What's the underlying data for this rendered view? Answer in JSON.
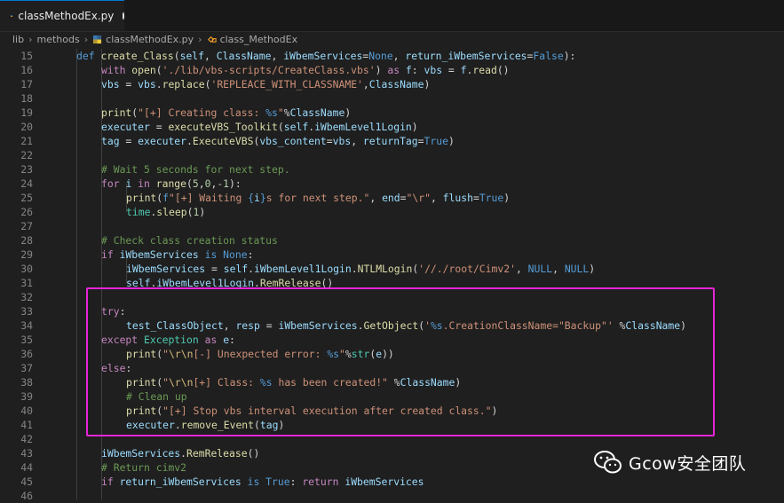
{
  "tab": {
    "filename": "classMethodEx.py"
  },
  "breadcrumb": {
    "part1": "lib",
    "part2": "methods",
    "part3": "classMethodEx.py",
    "part4": "class_MethodEx"
  },
  "code": {
    "l15": {
      "num": "15",
      "t1": "def ",
      "t2": "create_Class",
      "t3": "(",
      "t4": "self",
      "t5": ", ",
      "t6": "ClassName",
      "t7": ", ",
      "t8": "iWbemServices",
      "t9": "=",
      "t10": "None",
      "t11": ", ",
      "t12": "return_iWbemServices",
      "t13": "=",
      "t14": "False",
      "t15": "):"
    },
    "l16": {
      "num": "16",
      "t1": "with ",
      "t2": "open",
      "t3": "(",
      "t4": "'./lib/vbs-scripts/CreateClass.vbs'",
      "t5": ") ",
      "t6": "as ",
      "t7": "f",
      "t8": ": ",
      "t9": "vbs",
      "t10": " = ",
      "t11": "f",
      "t12": ".",
      "t13": "read",
      "t14": "()"
    },
    "l17": {
      "num": "17",
      "t1": "vbs",
      "t2": " = ",
      "t3": "vbs",
      "t4": ".",
      "t5": "replace",
      "t6": "(",
      "t7": "'REPLEACE_WITH_CLASSNAME'",
      "t8": ",",
      "t9": "ClassName",
      "t10": ")"
    },
    "l18": {
      "num": "18"
    },
    "l19": {
      "num": "19",
      "t1": "print",
      "t2": "(",
      "t3": "\"[+] Creating class: ",
      "t4": "%s",
      "t5": "\"",
      "t6": "%",
      "t7": "ClassName",
      "t8": ")"
    },
    "l20": {
      "num": "20",
      "t1": "executer",
      "t2": " = ",
      "t3": "executeVBS_Toolkit",
      "t4": "(",
      "t5": "self",
      "t6": ".",
      "t7": "iWbemLevel1Login",
      "t8": ")"
    },
    "l21": {
      "num": "21",
      "t1": "tag",
      "t2": " = ",
      "t3": "executer",
      "t4": ".",
      "t5": "ExecuteVBS",
      "t6": "(",
      "t7": "vbs_content",
      "t8": "=",
      "t9": "vbs",
      "t10": ", ",
      "t11": "returnTag",
      "t12": "=",
      "t13": "True",
      "t14": ")"
    },
    "l22": {
      "num": "22"
    },
    "l23": {
      "num": "23",
      "t1": "# Wait 5 seconds for next step."
    },
    "l24": {
      "num": "24",
      "t1": "for ",
      "t2": "i",
      "t3": " in ",
      "t4": "range",
      "t5": "(",
      "t6": "5",
      "t7": ",",
      "t8": "0",
      "t9": ",",
      "t10": "-1",
      "t11": "):"
    },
    "l25": {
      "num": "25",
      "t1": "print",
      "t2": "(",
      "t3": "f",
      "t4": "\"[+] Waiting ",
      "t5": "{",
      "t6": "i",
      "t7": "}",
      "t8": "s for next step.\"",
      "t9": ", ",
      "t10": "end",
      "t11": "=",
      "t12": "\"\\r\"",
      "t13": ", ",
      "t14": "flush",
      "t15": "=",
      "t16": "True",
      "t17": ")"
    },
    "l26": {
      "num": "26",
      "t1": "time",
      "t2": ".",
      "t3": "sleep",
      "t4": "(",
      "t5": "1",
      "t6": ")"
    },
    "l27": {
      "num": "27"
    },
    "l28": {
      "num": "28",
      "t1": "# Check class creation status"
    },
    "l29": {
      "num": "29",
      "t1": "if ",
      "t2": "iWbemServices",
      "t3": " is ",
      "t4": "None",
      "t5": ":"
    },
    "l30": {
      "num": "30",
      "t1": "iWbemServices",
      "t2": " = ",
      "t3": "self",
      "t4": ".",
      "t5": "iWbemLevel1Login",
      "t6": ".",
      "t7": "NTLMLogin",
      "t8": "(",
      "t9": "'//./root/Cimv2'",
      "t10": ", ",
      "t11": "NULL",
      "t12": ", ",
      "t13": "NULL",
      "t14": ")"
    },
    "l31": {
      "num": "31",
      "t1": "self",
      "t2": ".",
      "t3": "iWbemLevel1Login",
      "t4": ".",
      "t5": "RemRelease",
      "t6": "()"
    },
    "l32": {
      "num": "32"
    },
    "l33": {
      "num": "33",
      "t1": "try",
      "t2": ":"
    },
    "l34": {
      "num": "34",
      "t1": "test_ClassObject",
      "t2": ", ",
      "t3": "resp",
      "t4": " = ",
      "t5": "iWbemServices",
      "t6": ".",
      "t7": "GetObject",
      "t8": "(",
      "t9": "'",
      "t10": "%s",
      "t11": ".CreationClassName=\"Backup\"'",
      "t12": " ",
      "t13": "%",
      "t14": "ClassName",
      "t15": ")"
    },
    "l35": {
      "num": "35",
      "t1": "except ",
      "t2": "Exception",
      "t3": " as ",
      "t4": "e",
      "t5": ":"
    },
    "l36": {
      "num": "36",
      "t1": "print",
      "t2": "(",
      "t3": "\"",
      "t4": "\\r\\n",
      "t5": "[-] Unexpected error: ",
      "t6": "%s",
      "t7": "\"",
      "t8": "%",
      "t9": "str",
      "t10": "(",
      "t11": "e",
      "t12": "))"
    },
    "l37": {
      "num": "37",
      "t1": "else",
      "t2": ":"
    },
    "l38": {
      "num": "38",
      "t1": "print",
      "t2": "(",
      "t3": "\"",
      "t4": "\\r\\n",
      "t5": "[+] Class: ",
      "t6": "%s",
      "t7": " has been created!\"",
      "t8": " ",
      "t9": "%",
      "t10": "ClassName",
      "t11": ")"
    },
    "l39": {
      "num": "39",
      "t1": "# Clean up"
    },
    "l40": {
      "num": "40",
      "t1": "print",
      "t2": "(",
      "t3": "\"[+] Stop vbs interval execution after created class.\"",
      "t4": ")"
    },
    "l41": {
      "num": "41",
      "t1": "executer",
      "t2": ".",
      "t3": "remove_Event",
      "t4": "(",
      "t5": "tag",
      "t6": ")"
    },
    "l42": {
      "num": "42"
    },
    "l43": {
      "num": "43",
      "t1": "iWbemServices",
      "t2": ".",
      "t3": "RemRelease",
      "t4": "()"
    },
    "l44": {
      "num": "44",
      "t1": "# Return cimv2"
    },
    "l45": {
      "num": "45",
      "t1": "if ",
      "t2": "return_iWbemServices",
      "t3": " is ",
      "t4": "True",
      "t5": ": ",
      "t6": "return ",
      "t7": "iWbemServices"
    },
    "l46": {
      "num": "46"
    }
  },
  "watermark": {
    "text": "Gcow安全团队",
    "icon": "wechat-icon"
  },
  "colors": {
    "highlight_box": "#e624d8",
    "keyword": "#569cd6",
    "control": "#c586c0",
    "function": "#dcdcaa",
    "string": "#ce9178",
    "comment": "#6a9955",
    "variable": "#9cdcfe",
    "type": "#4ec9b0",
    "number": "#b5cea8"
  }
}
